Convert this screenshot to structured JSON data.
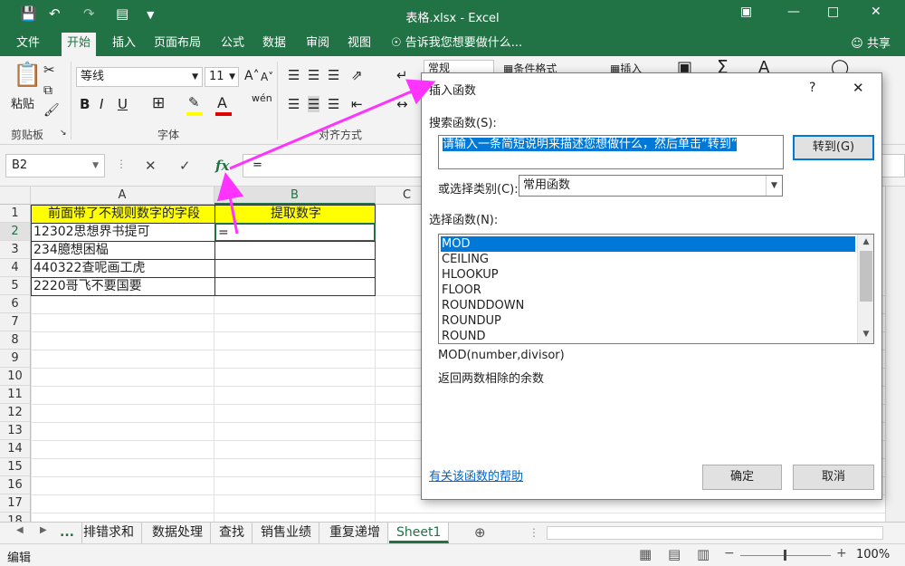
{
  "window": {
    "title": "表格.xlsx - Excel"
  },
  "ribbon_tabs": [
    "文件",
    "开始",
    "插入",
    "页面布局",
    "公式",
    "数据",
    "审阅",
    "视图"
  ],
  "tell_me": "告诉我您想要做什么...",
  "share_label": "共享",
  "ribbon": {
    "paste_label": "粘贴",
    "font_name": "等线",
    "font_size": "11",
    "number_format": "常规",
    "conditional_format": "条件格式",
    "insert_label": "插入",
    "groups": {
      "clipboard": "剪贴板",
      "font": "字体",
      "alignment": "对齐方式"
    }
  },
  "formula_bar": {
    "name_box": "B2",
    "content": "="
  },
  "grid": {
    "columns": [
      "A",
      "B",
      "C"
    ],
    "rows": [
      "1",
      "2",
      "3",
      "4",
      "5",
      "6",
      "7",
      "8",
      "9",
      "10",
      "11",
      "12",
      "13",
      "14",
      "15",
      "16",
      "17",
      "18"
    ],
    "cells": {
      "A1": "前面带了不规则数字的字段",
      "B1": "提取数字",
      "A2": "12302思想界书提可",
      "B2": "=",
      "A3": "234臆想困榀",
      "A4": "440322查呢画工虎",
      "A5": "2220哥飞不要国要"
    }
  },
  "sheet_tabs": {
    "more": "...",
    "tabs": [
      "排错求和",
      "数据处理",
      "查找",
      "销售业绩",
      "重复递增",
      "Sheet1"
    ],
    "active": "Sheet1"
  },
  "status": {
    "mode": "编辑",
    "zoom": "100%"
  },
  "dialog": {
    "title": "插入函数",
    "help_char": "?",
    "close_char": "✕",
    "search_label": "搜索函数(S):",
    "search_value": "请输入一条简短说明来描述您想做什么，然后单击“转到”",
    "goto_button": "转到(G)",
    "category_label": "或选择类别(C):",
    "category_value": "常用函数",
    "function_label": "选择函数(N):",
    "functions": [
      "MOD",
      "CEILING",
      "HLOOKUP",
      "FLOOR",
      "ROUNDDOWN",
      "ROUNDUP",
      "ROUND"
    ],
    "selected_function": "MOD",
    "syntax": "MOD(number,divisor)",
    "description": "返回两数相除的余数",
    "help_link": "有关该函数的帮助",
    "ok_button": "确定",
    "cancel_button": "取消"
  },
  "colors": {
    "excel_green": "#217346",
    "header_yellow": "#ffff00",
    "selection_blue": "#0078d7",
    "annotation_magenta": "#ff33ff"
  }
}
